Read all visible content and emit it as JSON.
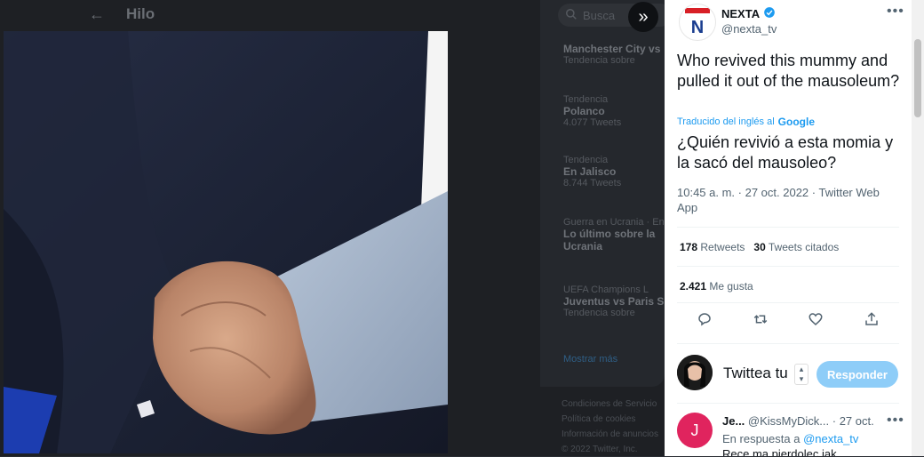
{
  "background": {
    "header": {
      "back_icon": "←",
      "title": "Hilo"
    },
    "search": {
      "placeholder": "Busca"
    },
    "trends": [
      {
        "context": "",
        "topic": "Manchester City vs",
        "count": "Tendencia sobre"
      },
      {
        "context": "Tendencia",
        "topic": "Polanco",
        "count": "4.077 Tweets"
      },
      {
        "context": "Tendencia",
        "topic": "En Jalisco",
        "count": "8.744 Tweets"
      },
      {
        "context": "Guerra en Ucrania · En",
        "topic": "Lo último sobre la",
        "count": "Ucrania"
      },
      {
        "context": "UEFA Champions L",
        "topic": "Juventus vs Paris S",
        "count": "Tendencia sobre"
      }
    ],
    "show_more": "Mostrar más",
    "footer": [
      "Condiciones de Servicio",
      "Política de cookies",
      "Información de anuncios",
      "© 2022 Twitter, Inc."
    ]
  },
  "tweet": {
    "name": "NEXTA",
    "handle": "@nexta_tv",
    "text": "Who revived this mummy and pulled it out of the mausoleum?",
    "translated_label": "Traducido del inglés al",
    "translator": "Google",
    "translation": "¿Quién revivió a esta momia y la sacó del mausoleo?",
    "meta": "10:45 a. m. · 27 oct. 2022 · Twitter Web App",
    "retweets": "178",
    "retweets_label": "Retweets",
    "quotes": "30",
    "quotes_label": "Tweets citados",
    "likes": "2.421",
    "likes_label": "Me gusta"
  },
  "composer": {
    "placeholder": "Twittea tu",
    "reply_label": "Responder"
  },
  "reply": {
    "initial": "J",
    "name": "Je...",
    "handle": "@KissMyDick...",
    "date": "· 27 oct.",
    "in_reply_prefix": "En respuesta a",
    "in_reply_to": "@nexta_tv",
    "text": "Rece ma pierdolec jak"
  },
  "colors": {
    "accent": "#1d9bf0",
    "verified": "#1d9bf0",
    "reply_button": "#8ecdf8",
    "reply_avatar": "#e0245e"
  }
}
